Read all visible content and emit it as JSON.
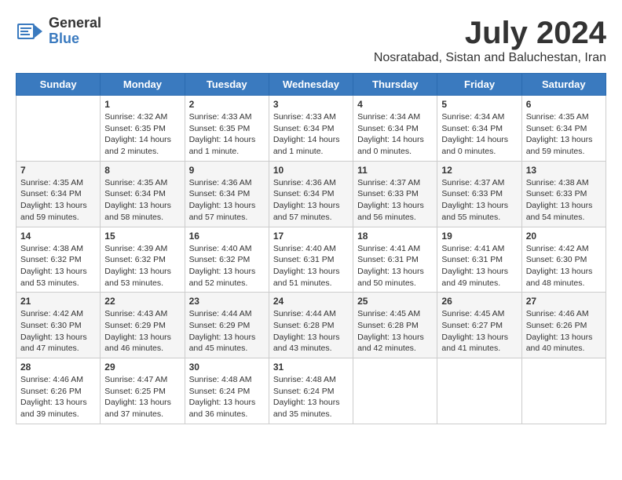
{
  "logo": {
    "general": "General",
    "blue": "Blue"
  },
  "title": "July 2024",
  "subtitle": "Nosratabad, Sistan and Baluchestan, Iran",
  "days": [
    "Sunday",
    "Monday",
    "Tuesday",
    "Wednesday",
    "Thursday",
    "Friday",
    "Saturday"
  ],
  "weeks": [
    [
      {
        "day": "",
        "content": ""
      },
      {
        "day": "1",
        "content": "Sunrise: 4:32 AM\nSunset: 6:35 PM\nDaylight: 14 hours\nand 2 minutes."
      },
      {
        "day": "2",
        "content": "Sunrise: 4:33 AM\nSunset: 6:35 PM\nDaylight: 14 hours\nand 1 minute."
      },
      {
        "day": "3",
        "content": "Sunrise: 4:33 AM\nSunset: 6:34 PM\nDaylight: 14 hours\nand 1 minute."
      },
      {
        "day": "4",
        "content": "Sunrise: 4:34 AM\nSunset: 6:34 PM\nDaylight: 14 hours\nand 0 minutes."
      },
      {
        "day": "5",
        "content": "Sunrise: 4:34 AM\nSunset: 6:34 PM\nDaylight: 14 hours\nand 0 minutes."
      },
      {
        "day": "6",
        "content": "Sunrise: 4:35 AM\nSunset: 6:34 PM\nDaylight: 13 hours\nand 59 minutes."
      }
    ],
    [
      {
        "day": "7",
        "content": "Sunrise: 4:35 AM\nSunset: 6:34 PM\nDaylight: 13 hours\nand 59 minutes."
      },
      {
        "day": "8",
        "content": "Sunrise: 4:35 AM\nSunset: 6:34 PM\nDaylight: 13 hours\nand 58 minutes."
      },
      {
        "day": "9",
        "content": "Sunrise: 4:36 AM\nSunset: 6:34 PM\nDaylight: 13 hours\nand 57 minutes."
      },
      {
        "day": "10",
        "content": "Sunrise: 4:36 AM\nSunset: 6:34 PM\nDaylight: 13 hours\nand 57 minutes."
      },
      {
        "day": "11",
        "content": "Sunrise: 4:37 AM\nSunset: 6:33 PM\nDaylight: 13 hours\nand 56 minutes."
      },
      {
        "day": "12",
        "content": "Sunrise: 4:37 AM\nSunset: 6:33 PM\nDaylight: 13 hours\nand 55 minutes."
      },
      {
        "day": "13",
        "content": "Sunrise: 4:38 AM\nSunset: 6:33 PM\nDaylight: 13 hours\nand 54 minutes."
      }
    ],
    [
      {
        "day": "14",
        "content": "Sunrise: 4:38 AM\nSunset: 6:32 PM\nDaylight: 13 hours\nand 53 minutes."
      },
      {
        "day": "15",
        "content": "Sunrise: 4:39 AM\nSunset: 6:32 PM\nDaylight: 13 hours\nand 53 minutes."
      },
      {
        "day": "16",
        "content": "Sunrise: 4:40 AM\nSunset: 6:32 PM\nDaylight: 13 hours\nand 52 minutes."
      },
      {
        "day": "17",
        "content": "Sunrise: 4:40 AM\nSunset: 6:31 PM\nDaylight: 13 hours\nand 51 minutes."
      },
      {
        "day": "18",
        "content": "Sunrise: 4:41 AM\nSunset: 6:31 PM\nDaylight: 13 hours\nand 50 minutes."
      },
      {
        "day": "19",
        "content": "Sunrise: 4:41 AM\nSunset: 6:31 PM\nDaylight: 13 hours\nand 49 minutes."
      },
      {
        "day": "20",
        "content": "Sunrise: 4:42 AM\nSunset: 6:30 PM\nDaylight: 13 hours\nand 48 minutes."
      }
    ],
    [
      {
        "day": "21",
        "content": "Sunrise: 4:42 AM\nSunset: 6:30 PM\nDaylight: 13 hours\nand 47 minutes."
      },
      {
        "day": "22",
        "content": "Sunrise: 4:43 AM\nSunset: 6:29 PM\nDaylight: 13 hours\nand 46 minutes."
      },
      {
        "day": "23",
        "content": "Sunrise: 4:44 AM\nSunset: 6:29 PM\nDaylight: 13 hours\nand 45 minutes."
      },
      {
        "day": "24",
        "content": "Sunrise: 4:44 AM\nSunset: 6:28 PM\nDaylight: 13 hours\nand 43 minutes."
      },
      {
        "day": "25",
        "content": "Sunrise: 4:45 AM\nSunset: 6:28 PM\nDaylight: 13 hours\nand 42 minutes."
      },
      {
        "day": "26",
        "content": "Sunrise: 4:45 AM\nSunset: 6:27 PM\nDaylight: 13 hours\nand 41 minutes."
      },
      {
        "day": "27",
        "content": "Sunrise: 4:46 AM\nSunset: 6:26 PM\nDaylight: 13 hours\nand 40 minutes."
      }
    ],
    [
      {
        "day": "28",
        "content": "Sunrise: 4:46 AM\nSunset: 6:26 PM\nDaylight: 13 hours\nand 39 minutes."
      },
      {
        "day": "29",
        "content": "Sunrise: 4:47 AM\nSunset: 6:25 PM\nDaylight: 13 hours\nand 37 minutes."
      },
      {
        "day": "30",
        "content": "Sunrise: 4:48 AM\nSunset: 6:24 PM\nDaylight: 13 hours\nand 36 minutes."
      },
      {
        "day": "31",
        "content": "Sunrise: 4:48 AM\nSunset: 6:24 PM\nDaylight: 13 hours\nand 35 minutes."
      },
      {
        "day": "",
        "content": ""
      },
      {
        "day": "",
        "content": ""
      },
      {
        "day": "",
        "content": ""
      }
    ]
  ]
}
